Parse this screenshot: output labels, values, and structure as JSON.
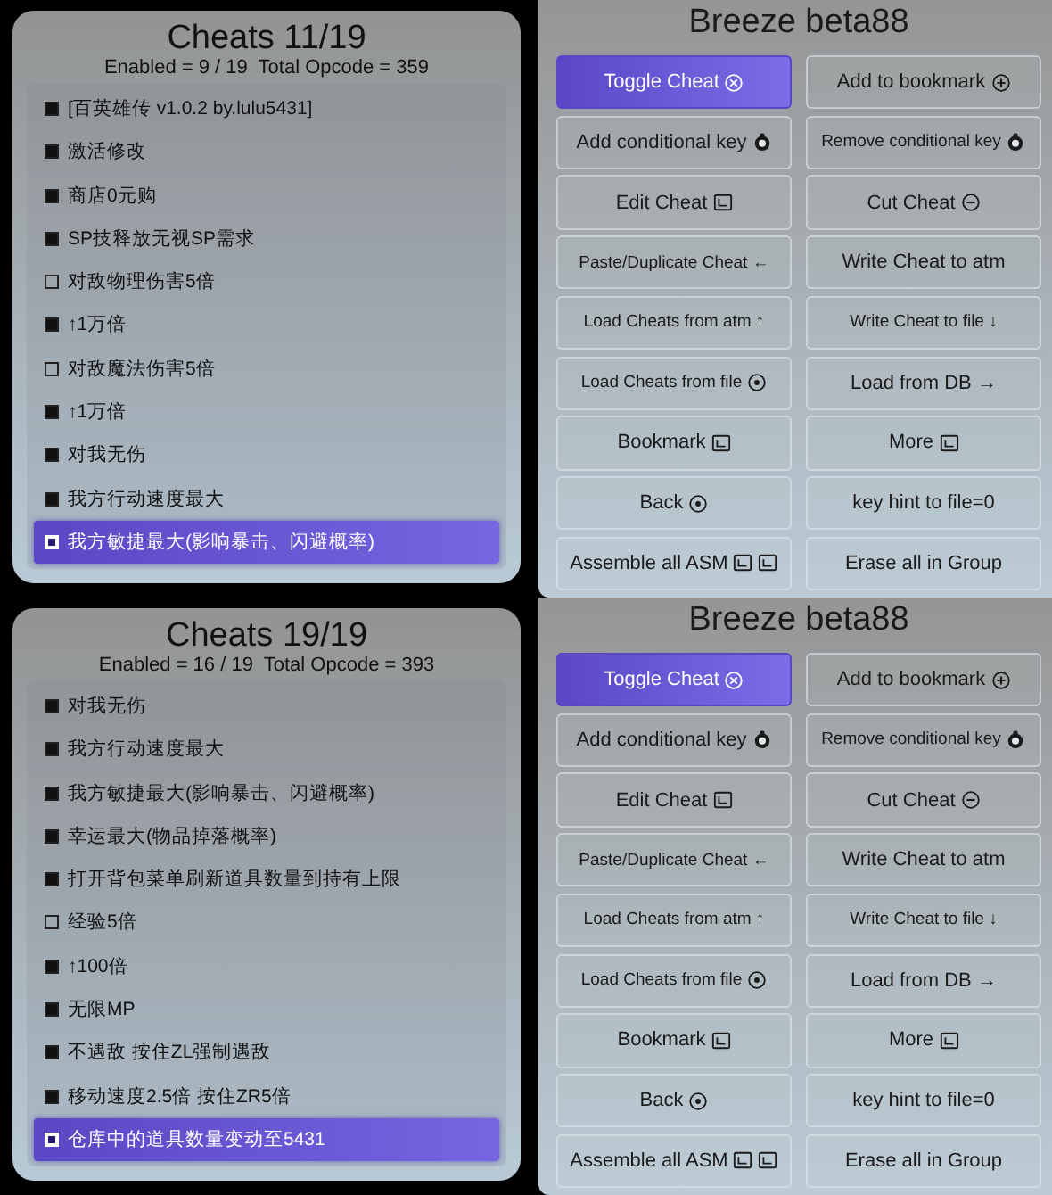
{
  "screens": [
    {
      "cheats": {
        "title": "Cheats 11/19",
        "summary": "Enabled = 9 / 19  Total Opcode = 359",
        "items": [
          {
            "label": "[百英雄传 v1.0.2 by.lulu5431]",
            "enabled": true,
            "selected": false
          },
          {
            "label": "激活修改",
            "enabled": true,
            "selected": false
          },
          {
            "label": "商店0元购",
            "enabled": true,
            "selected": false
          },
          {
            "label": "SP技释放无视SP需求",
            "enabled": true,
            "selected": false
          },
          {
            "label": "对敌物理伤害5倍",
            "enabled": false,
            "selected": false
          },
          {
            "label": "↑1万倍",
            "enabled": true,
            "selected": false
          },
          {
            "label": "对敌魔法伤害5倍",
            "enabled": false,
            "selected": false
          },
          {
            "label": "↑1万倍",
            "enabled": true,
            "selected": false
          },
          {
            "label": "对我无伤",
            "enabled": true,
            "selected": false
          },
          {
            "label": "我方行动速度最大",
            "enabled": true,
            "selected": false
          },
          {
            "label": "我方敏捷最大(影响暴击、闪避概率)",
            "enabled": true,
            "selected": true
          }
        ]
      },
      "menu": {
        "title": "Breeze beta88",
        "buttons": [
          {
            "label": "Toggle Cheat",
            "icons": [
              {
                "kind": "circle-x"
              }
            ],
            "selected": true
          },
          {
            "label": "Add to bookmark",
            "icons": [
              {
                "kind": "circle-plus"
              }
            ],
            "selected": false
          },
          {
            "label": "Add conditional key",
            "icons": [
              {
                "kind": "stick"
              }
            ],
            "selected": false
          },
          {
            "label": "Remove conditional key",
            "icons": [
              {
                "kind": "stick"
              }
            ],
            "selected": false
          },
          {
            "label": "Edit Cheat",
            "icons": [
              {
                "kind": "box"
              }
            ],
            "selected": false
          },
          {
            "label": "Cut Cheat",
            "icons": [
              {
                "kind": "circle-minus"
              }
            ],
            "selected": false
          },
          {
            "label": "Paste/Duplicate Cheat ←",
            "selected": false
          },
          {
            "label": "Write Cheat to atm",
            "selected": false
          },
          {
            "label": "Load Cheats from atm ↑",
            "selected": false
          },
          {
            "label": "Write Cheat to file ↓",
            "selected": false
          },
          {
            "label": "Load Cheats from file",
            "icons": [
              {
                "kind": "circle-dot"
              }
            ],
            "selected": false
          },
          {
            "label": "Load from DB →",
            "selected": false
          },
          {
            "label": "Bookmark",
            "icons": [
              {
                "kind": "box"
              }
            ],
            "selected": false
          },
          {
            "label": "More",
            "icons": [
              {
                "kind": "box"
              }
            ],
            "selected": false
          },
          {
            "label": "Back",
            "icons": [
              {
                "kind": "circle-dot"
              }
            ],
            "selected": false
          },
          {
            "label": "key hint to file=0",
            "selected": false
          },
          {
            "label": "Assemble all ASM",
            "icons": [
              {
                "kind": "box"
              },
              {
                "kind": "box"
              }
            ],
            "selected": false
          },
          {
            "label": "Erase all in Group",
            "selected": false
          }
        ]
      }
    },
    {
      "cheats": {
        "title": "Cheats 19/19",
        "summary": "Enabled = 16 / 19  Total Opcode = 393",
        "items": [
          {
            "label": "对我无伤",
            "enabled": true,
            "selected": false
          },
          {
            "label": "我方行动速度最大",
            "enabled": true,
            "selected": false
          },
          {
            "label": "我方敏捷最大(影响暴击、闪避概率)",
            "enabled": true,
            "selected": false
          },
          {
            "label": "幸运最大(物品掉落概率)",
            "enabled": true,
            "selected": false
          },
          {
            "label": "打开背包菜单刷新道具数量到持有上限",
            "enabled": true,
            "selected": false
          },
          {
            "label": "经验5倍",
            "enabled": false,
            "selected": false
          },
          {
            "label": "↑100倍",
            "enabled": true,
            "selected": false
          },
          {
            "label": "无限MP",
            "enabled": true,
            "selected": false
          },
          {
            "label": "不遇敌 按住ZL强制遇敌",
            "enabled": true,
            "selected": false
          },
          {
            "label": "移动速度2.5倍 按住ZR5倍",
            "enabled": true,
            "selected": false
          },
          {
            "label": "仓库中的道具数量变动至5431",
            "enabled": true,
            "selected": true
          }
        ]
      },
      "menu": {
        "title": "Breeze beta88",
        "buttons": [
          {
            "label": "Toggle Cheat",
            "icons": [
              {
                "kind": "circle-x"
              }
            ],
            "selected": true
          },
          {
            "label": "Add to bookmark",
            "icons": [
              {
                "kind": "circle-plus"
              }
            ],
            "selected": false
          },
          {
            "label": "Add conditional key",
            "icons": [
              {
                "kind": "stick"
              }
            ],
            "selected": false
          },
          {
            "label": "Remove conditional key",
            "icons": [
              {
                "kind": "stick"
              }
            ],
            "selected": false
          },
          {
            "label": "Edit Cheat",
            "icons": [
              {
                "kind": "box"
              }
            ],
            "selected": false
          },
          {
            "label": "Cut Cheat",
            "icons": [
              {
                "kind": "circle-minus"
              }
            ],
            "selected": false
          },
          {
            "label": "Paste/Duplicate Cheat ←",
            "selected": false
          },
          {
            "label": "Write Cheat to atm",
            "selected": false
          },
          {
            "label": "Load Cheats from atm ↑",
            "selected": false
          },
          {
            "label": "Write Cheat to file ↓",
            "selected": false
          },
          {
            "label": "Load Cheats from file",
            "icons": [
              {
                "kind": "circle-dot"
              }
            ],
            "selected": false
          },
          {
            "label": "Load from DB →",
            "selected": false
          },
          {
            "label": "Bookmark",
            "icons": [
              {
                "kind": "box"
              }
            ],
            "selected": false
          },
          {
            "label": "More",
            "icons": [
              {
                "kind": "box"
              }
            ],
            "selected": false
          },
          {
            "label": "Back",
            "icons": [
              {
                "kind": "circle-dot"
              }
            ],
            "selected": false
          },
          {
            "label": "key hint to file=0",
            "selected": false
          },
          {
            "label": "Assemble all ASM",
            "icons": [
              {
                "kind": "box"
              },
              {
                "kind": "box"
              }
            ],
            "selected": false
          },
          {
            "label": "Erase all in Group",
            "selected": false
          }
        ]
      }
    }
  ]
}
